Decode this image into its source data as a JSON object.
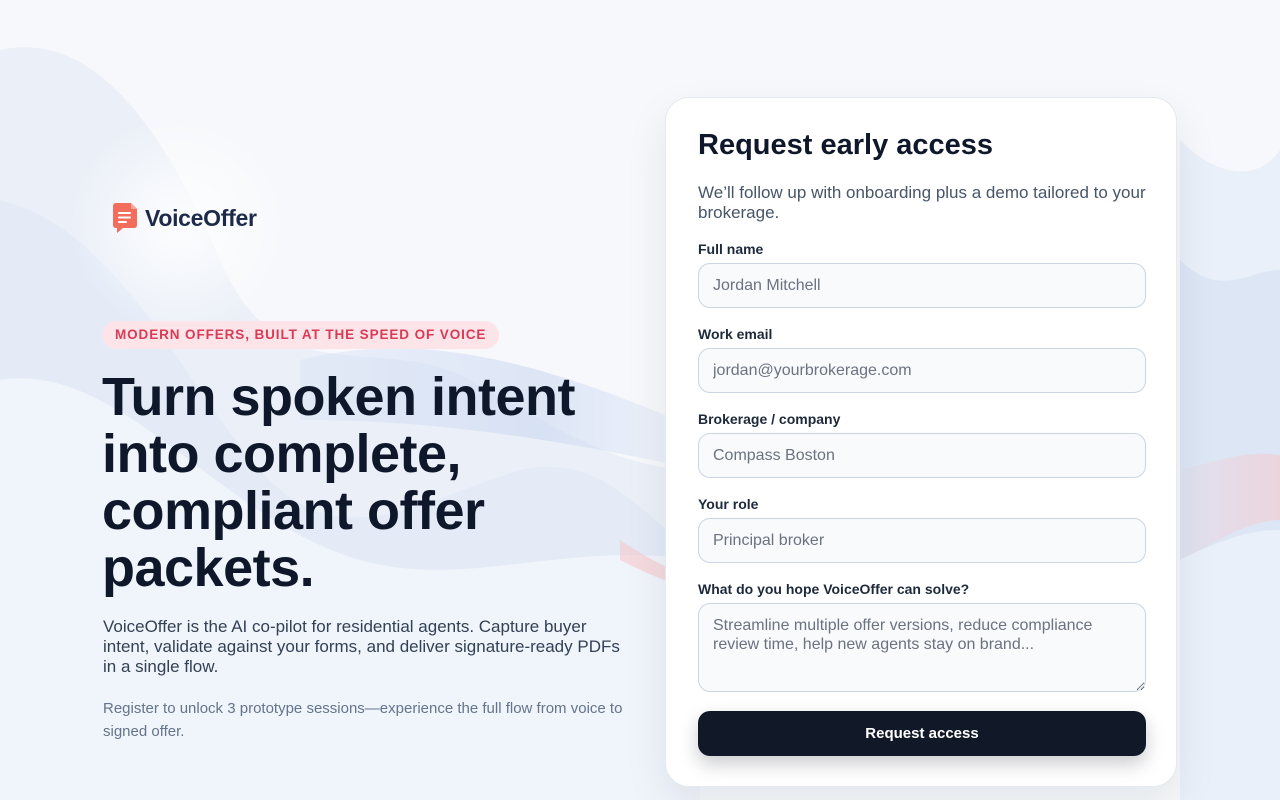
{
  "brand": {
    "name": "VoiceOffer",
    "logo_icon": "chat-document-icon",
    "logo_color": "#f26d5b"
  },
  "hero": {
    "tagline": "MODERN OFFERS, BUILT AT THE SPEED OF VOICE",
    "headline": "Turn spoken intent into complete, compliant offer packets.",
    "subcopy": "VoiceOffer is the AI co-pilot for residential agents. Capture buyer intent, validate against your forms, and deliver signature-ready PDFs in a single flow.",
    "note": "Register to unlock 3 prototype sessions—experience the full flow from voice to signed offer."
  },
  "form": {
    "title": "Request early access",
    "subtitle": "We’ll follow up with onboarding plus a demo tailored to your brokerage.",
    "fields": [
      {
        "label": "Full name",
        "placeholder": "Jordan Mitchell",
        "value": ""
      },
      {
        "label": "Work email",
        "placeholder": "jordan@yourbrokerage.com",
        "value": ""
      },
      {
        "label": "Brokerage / company",
        "placeholder": "Compass Boston",
        "value": ""
      },
      {
        "label": "Your role",
        "placeholder": "Principal broker",
        "value": ""
      }
    ],
    "problem": {
      "label": "What do you hope VoiceOffer can solve?",
      "placeholder": "Streamline multiple offer versions, reduce compliance review time, help new agents stay on brand...",
      "value": ""
    },
    "submit_label": "Request access"
  },
  "colors": {
    "primary": "#111827",
    "accent": "#d93a55",
    "tag_background": "#fde4e8",
    "background": "#f7f9fc"
  }
}
